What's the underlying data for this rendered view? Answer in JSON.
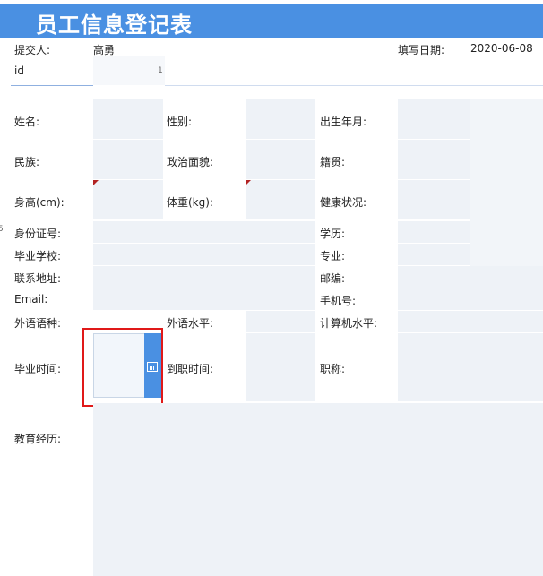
{
  "header": {
    "title": "员工信息登记表"
  },
  "meta": {
    "submitter_label": "提交人:",
    "submitter_value": "高勇",
    "fill_date_label": "填写日期:",
    "fill_date_value": "2020-06-08",
    "id_label": "id",
    "id_value": "1"
  },
  "fields": {
    "name": "姓名:",
    "gender": "性别:",
    "birth": "出生年月:",
    "ethnicity": "民族:",
    "politics": "政治面貌:",
    "hometown": "籍贯:",
    "height": "身高(cm):",
    "weight": "体重(kg):",
    "health": "健康状况:",
    "idcard": "身份证号:",
    "education": "学历:",
    "school": "毕业学校:",
    "major": "专业:",
    "address": "联系地址:",
    "postcode": "邮编:",
    "email": "Email:",
    "mobile": "手机号:",
    "lang_type": "外语语种:",
    "lang_level": "外语水平:",
    "computer_level": "计算机水平:",
    "grad_time": "毕业时间:",
    "join_time": "到职时间:",
    "title": "职称:",
    "edu_history": "教育经历:"
  },
  "left_edge_mark": "5"
}
